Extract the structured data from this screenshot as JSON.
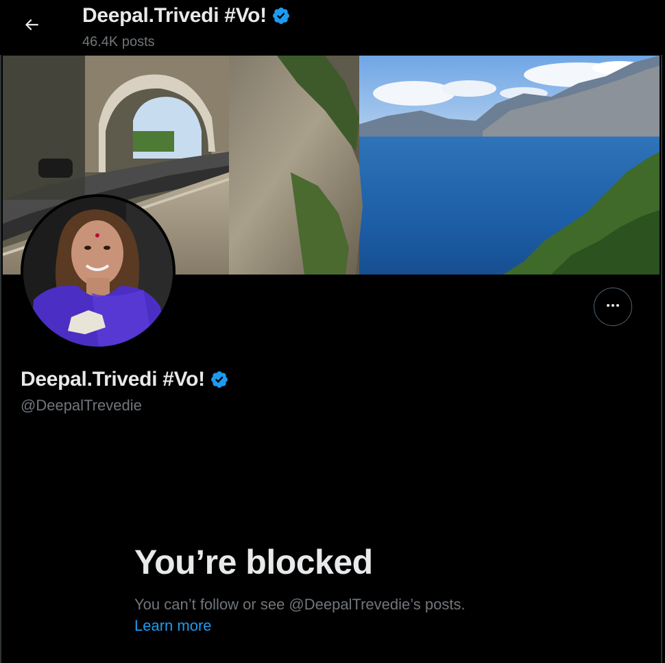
{
  "header": {
    "name": "Deepal.Trivedi #Vo!",
    "posts_count": "46.4K posts",
    "back_icon": "arrow-left-icon"
  },
  "profile": {
    "name": "Deepal.Trivedi #Vo!",
    "handle": "@DeepalTrevedie",
    "verified_icon": "verified-badge-icon",
    "more_icon": "more-horizontal-icon"
  },
  "blocked": {
    "title": "You’re blocked",
    "description": "You can’t follow or see @DeepalTrevedie’s posts.",
    "learn_more": "Learn more"
  },
  "colors": {
    "background": "#000000",
    "text_primary": "#e7e9ea",
    "text_secondary": "#71767b",
    "accent": "#1d9bf0",
    "verified": "#1d9bf0"
  }
}
